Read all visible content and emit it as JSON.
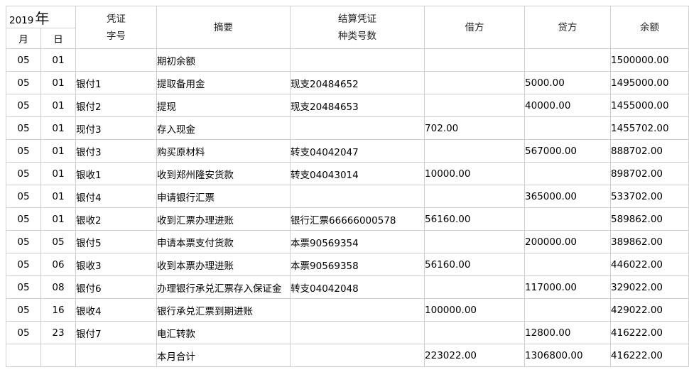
{
  "header": {
    "year_value": "2019",
    "year_char": "年",
    "month": "月",
    "day": "日",
    "voucher_line1": "凭证",
    "voucher_line2": "字号",
    "summary": "摘要",
    "settle_line1": "结算凭证",
    "settle_line2": "种类号数",
    "debit": "借方",
    "credit": "贷方",
    "balance": "余额"
  },
  "rows": [
    {
      "month": "05",
      "day": "01",
      "voucher": "",
      "summary": "期初余额",
      "settle": "",
      "debit": "",
      "credit": "",
      "balance": "1500000.00"
    },
    {
      "month": "05",
      "day": "01",
      "voucher": "银付1",
      "summary": "提取备用金",
      "settle": "现支20484652",
      "debit": "",
      "credit": "5000.00",
      "balance": "1495000.00"
    },
    {
      "month": "05",
      "day": "01",
      "voucher": "银付2",
      "summary": "提现",
      "settle": "现支20484653",
      "debit": "",
      "credit": "40000.00",
      "balance": "1455000.00"
    },
    {
      "month": "05",
      "day": "01",
      "voucher": "现付3",
      "summary": "存入现金",
      "settle": "",
      "debit": "702.00",
      "credit": "",
      "balance": "1455702.00"
    },
    {
      "month": "05",
      "day": "01",
      "voucher": "银付3",
      "summary": "购买原材料",
      "settle": "转支04042047",
      "debit": "",
      "credit": "567000.00",
      "balance": "888702.00"
    },
    {
      "month": "05",
      "day": "01",
      "voucher": "银收1",
      "summary": "收到郑州隆安货款",
      "settle": "转支04043014",
      "debit": "10000.00",
      "credit": "",
      "balance": "898702.00"
    },
    {
      "month": "05",
      "day": "01",
      "voucher": "银付4",
      "summary": "申请银行汇票",
      "settle": "",
      "debit": "",
      "credit": "365000.00",
      "balance": "533702.00"
    },
    {
      "month": "05",
      "day": "01",
      "voucher": "银收2",
      "summary": "收到汇票办理进账",
      "settle": "银行汇票66666000578",
      "debit": "56160.00",
      "credit": "",
      "balance": "589862.00"
    },
    {
      "month": "05",
      "day": "05",
      "voucher": "银付5",
      "summary": "申请本票支付货款",
      "settle": "本票90569354",
      "debit": "",
      "credit": "200000.00",
      "balance": "389862.00"
    },
    {
      "month": "05",
      "day": "06",
      "voucher": "银收3",
      "summary": "收到本票办理进账",
      "settle": "本票90569358",
      "debit": "56160.00",
      "credit": "",
      "balance": "446022.00"
    },
    {
      "month": "05",
      "day": "08",
      "voucher": "银付6",
      "summary": "办理银行承兑汇票存入保证金",
      "settle": "转支04042048",
      "debit": "",
      "credit": "117000.00",
      "balance": "329022.00"
    },
    {
      "month": "05",
      "day": "16",
      "voucher": "银收4",
      "summary": "银行承兑汇票到期进账",
      "settle": "",
      "debit": "100000.00",
      "credit": "",
      "balance": "429022.00"
    },
    {
      "month": "05",
      "day": "23",
      "voucher": "银付7",
      "summary": "电汇转款",
      "settle": "",
      "debit": "",
      "credit": "12800.00",
      "balance": "416222.00"
    },
    {
      "month": "",
      "day": "",
      "voucher": "",
      "summary": "本月合计",
      "settle": "",
      "debit": "223022.00",
      "credit": "1306800.00",
      "balance": "416222.00"
    }
  ]
}
